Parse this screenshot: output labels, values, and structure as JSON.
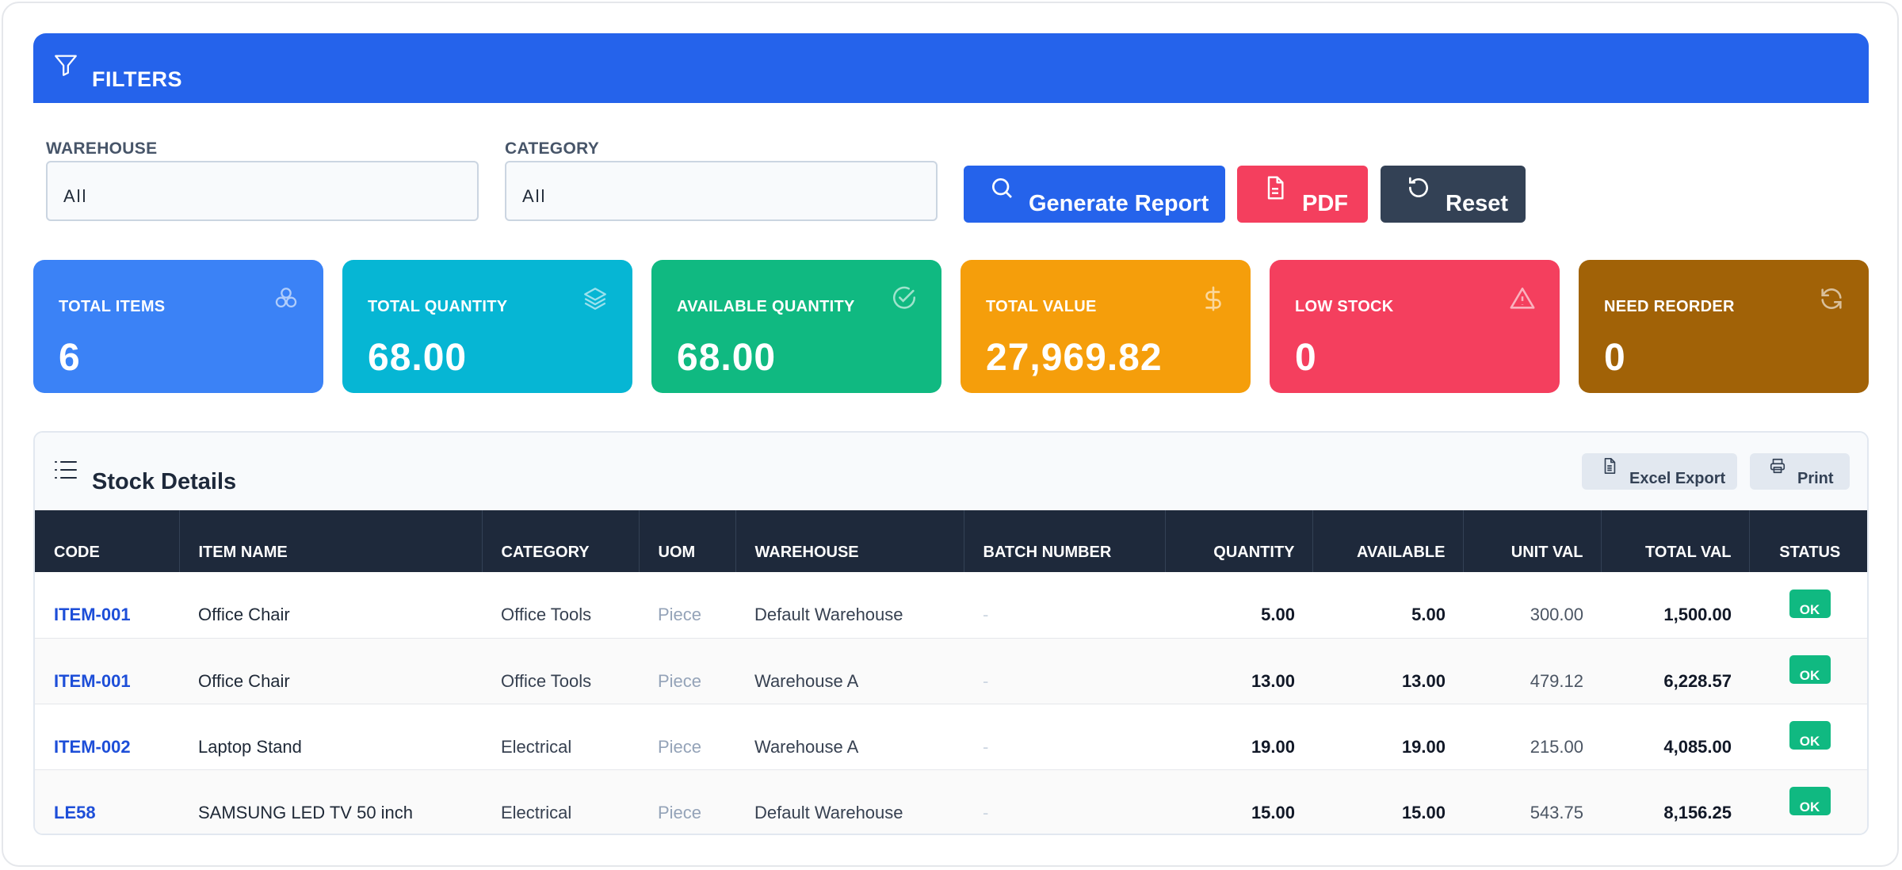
{
  "filters": {
    "title": "FILTERS",
    "warehouse": {
      "label": "WAREHOUSE",
      "value": "All"
    },
    "category": {
      "label": "CATEGORY",
      "value": "All"
    },
    "buttons": {
      "generate": "Generate Report",
      "pdf": "PDF",
      "reset": "Reset"
    }
  },
  "colors": {
    "header": "#2563eb",
    "total_items": "#3b82f6",
    "total_quantity": "#06b6d4",
    "available_quantity": "#10b981",
    "total_value": "#f59e0b",
    "low_stock": "#f43f5e",
    "need_reorder": "#a16207",
    "table_header": "#1e293b",
    "status_ok": "#10b981"
  },
  "stats": [
    {
      "label": "TOTAL ITEMS",
      "value": "6",
      "icon": "cubes-icon"
    },
    {
      "label": "TOTAL QUANTITY",
      "value": "68.00",
      "icon": "layers-icon"
    },
    {
      "label": "AVAILABLE QUANTITY",
      "value": "68.00",
      "icon": "check-circle-icon"
    },
    {
      "label": "TOTAL VALUE",
      "value": "27,969.82",
      "icon": "dollar-icon"
    },
    {
      "label": "LOW STOCK",
      "value": "0",
      "icon": "warning-icon"
    },
    {
      "label": "NEED REORDER",
      "value": "0",
      "icon": "refresh-icon"
    }
  ],
  "stock": {
    "title": "Stock Details",
    "excel_label": "Excel Export",
    "print_label": "Print",
    "columns": [
      "CODE",
      "ITEM NAME",
      "CATEGORY",
      "UOM",
      "WAREHOUSE",
      "BATCH NUMBER",
      "QUANTITY",
      "AVAILABLE",
      "UNIT VAL",
      "TOTAL VAL",
      "STATUS"
    ],
    "rows": [
      {
        "code": "ITEM-001",
        "name": "Office Chair",
        "category": "Office Tools",
        "uom": "Piece",
        "warehouse": "Default Warehouse",
        "batch": "-",
        "quantity": "5.00",
        "available": "5.00",
        "unit_val": "300.00",
        "total_val": "1,500.00",
        "status": "OK"
      },
      {
        "code": "ITEM-001",
        "name": "Office Chair",
        "category": "Office Tools",
        "uom": "Piece",
        "warehouse": "Warehouse A",
        "batch": "-",
        "quantity": "13.00",
        "available": "13.00",
        "unit_val": "479.12",
        "total_val": "6,228.57",
        "status": "OK"
      },
      {
        "code": "ITEM-002",
        "name": "Laptop Stand",
        "category": "Electrical",
        "uom": "Piece",
        "warehouse": "Warehouse A",
        "batch": "-",
        "quantity": "19.00",
        "available": "19.00",
        "unit_val": "215.00",
        "total_val": "4,085.00",
        "status": "OK"
      },
      {
        "code": "LE58",
        "name": "SAMSUNG LED TV 50 inch",
        "category": "Electrical",
        "uom": "Piece",
        "warehouse": "Default Warehouse",
        "batch": "-",
        "quantity": "15.00",
        "available": "15.00",
        "unit_val": "543.75",
        "total_val": "8,156.25",
        "status": "OK"
      }
    ]
  }
}
